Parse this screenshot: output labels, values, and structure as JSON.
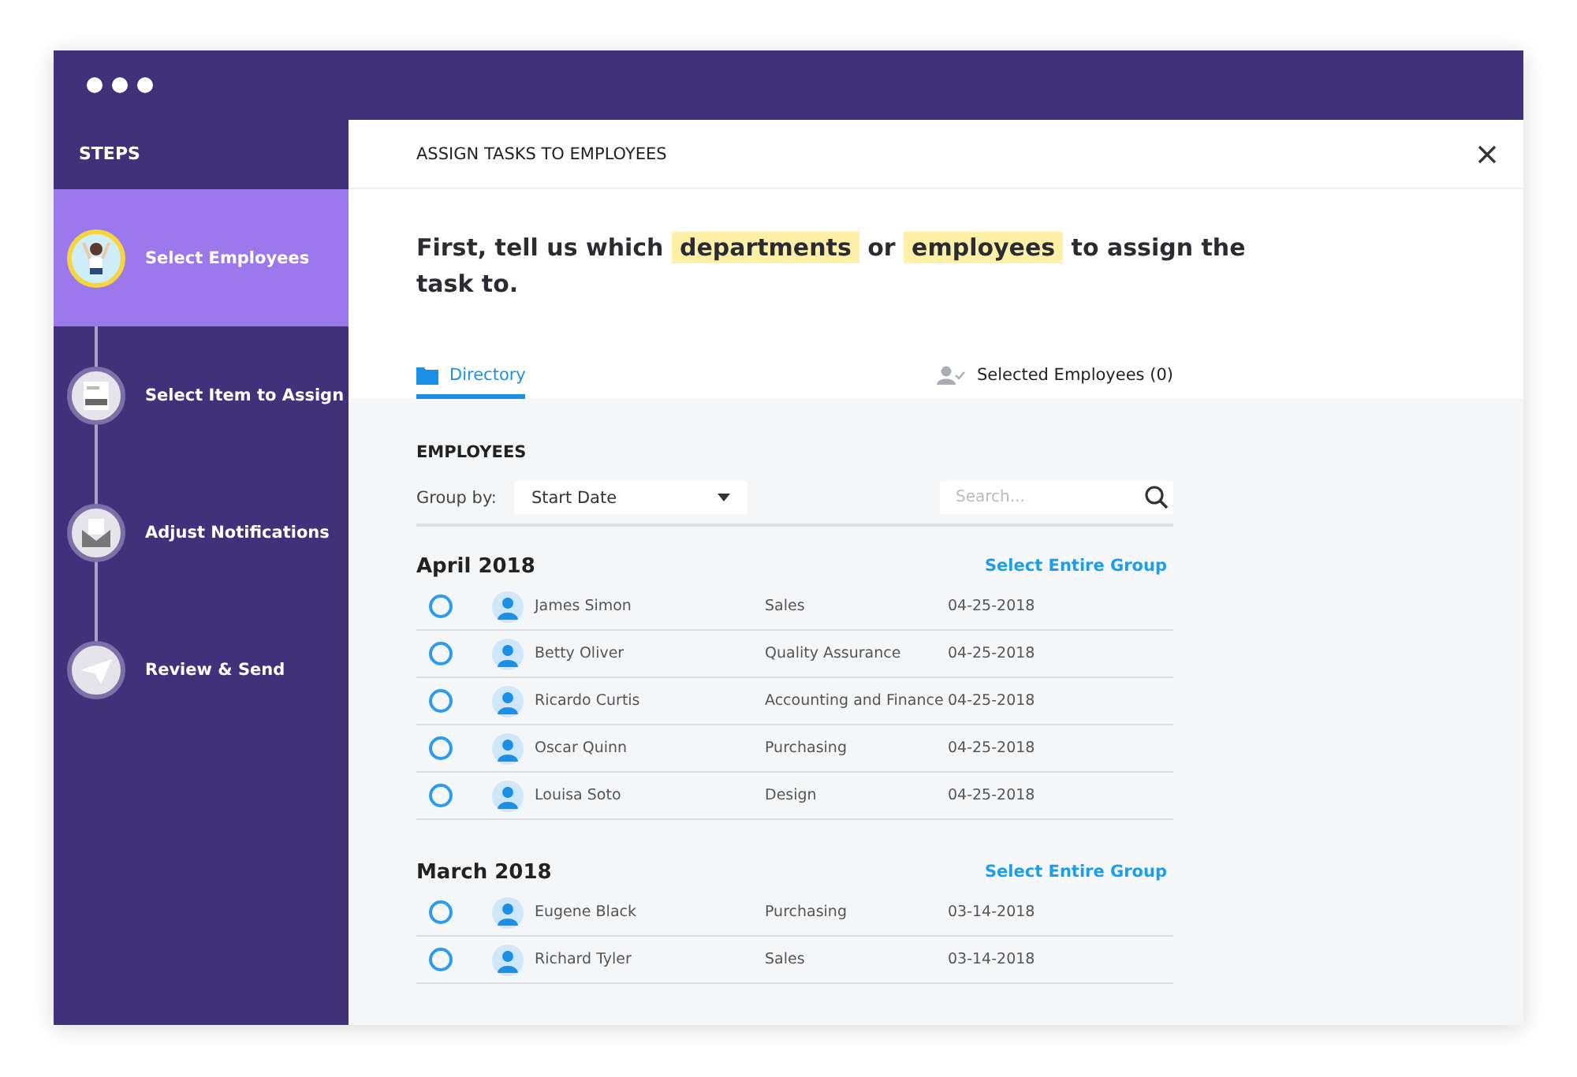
{
  "sidebar": {
    "title": "STEPS",
    "steps": [
      {
        "label": "Select Employees",
        "kind": "person",
        "selected": true
      },
      {
        "label": "Select Item to Assign",
        "kind": "form",
        "selected": false
      },
      {
        "label": "Adjust Notifications",
        "kind": "envelope",
        "selected": false
      },
      {
        "label": "Review & Send",
        "kind": "send",
        "selected": false
      }
    ]
  },
  "panel": {
    "title": "ASSIGN TASKS TO EMPLOYEES",
    "heading": [
      {
        "text": "First, tell us which ",
        "highlight": false
      },
      {
        "text": "departments",
        "highlight": true
      },
      {
        "text": " or ",
        "highlight": false
      },
      {
        "text": "employees",
        "highlight": true
      },
      {
        "text": " to assign the task to.",
        "highlight": false
      }
    ],
    "tabs": [
      {
        "label": "Directory",
        "kind": "folder",
        "selected": true
      },
      {
        "label": "Selected Employees (0)",
        "kind": "person",
        "selected": false
      }
    ]
  },
  "employees": {
    "title": "EMPLOYEES",
    "group_by_label": "Group by:",
    "group_by_value": "Start Date",
    "search": {
      "placeholder": "Search..."
    },
    "groups": [
      {
        "title": "April 2018",
        "action": "Select Entire Group",
        "rows": [
          {
            "name": "James Simon",
            "department": "Sales",
            "date": "04-25-2018",
            "selected": false
          },
          {
            "name": "Betty Oliver",
            "department": "Quality Assurance",
            "date": "04-25-2018",
            "selected": false
          },
          {
            "name": "Ricardo Curtis",
            "department": "Accounting and Finance",
            "date": "04-25-2018",
            "selected": false
          },
          {
            "name": "Oscar Quinn",
            "department": "Purchasing",
            "date": "04-25-2018",
            "selected": false
          },
          {
            "name": "Louisa Soto",
            "department": "Design",
            "date": "04-25-2018",
            "selected": false
          }
        ]
      },
      {
        "title": "March 2018",
        "action": "Select Entire Group",
        "rows": [
          {
            "name": "Eugene Black",
            "department": "Purchasing",
            "date": "03-14-2018",
            "selected": false
          },
          {
            "name": "Richard Tyler",
            "department": "Sales",
            "date": "03-14-2018",
            "selected": false
          }
        ]
      }
    ]
  }
}
